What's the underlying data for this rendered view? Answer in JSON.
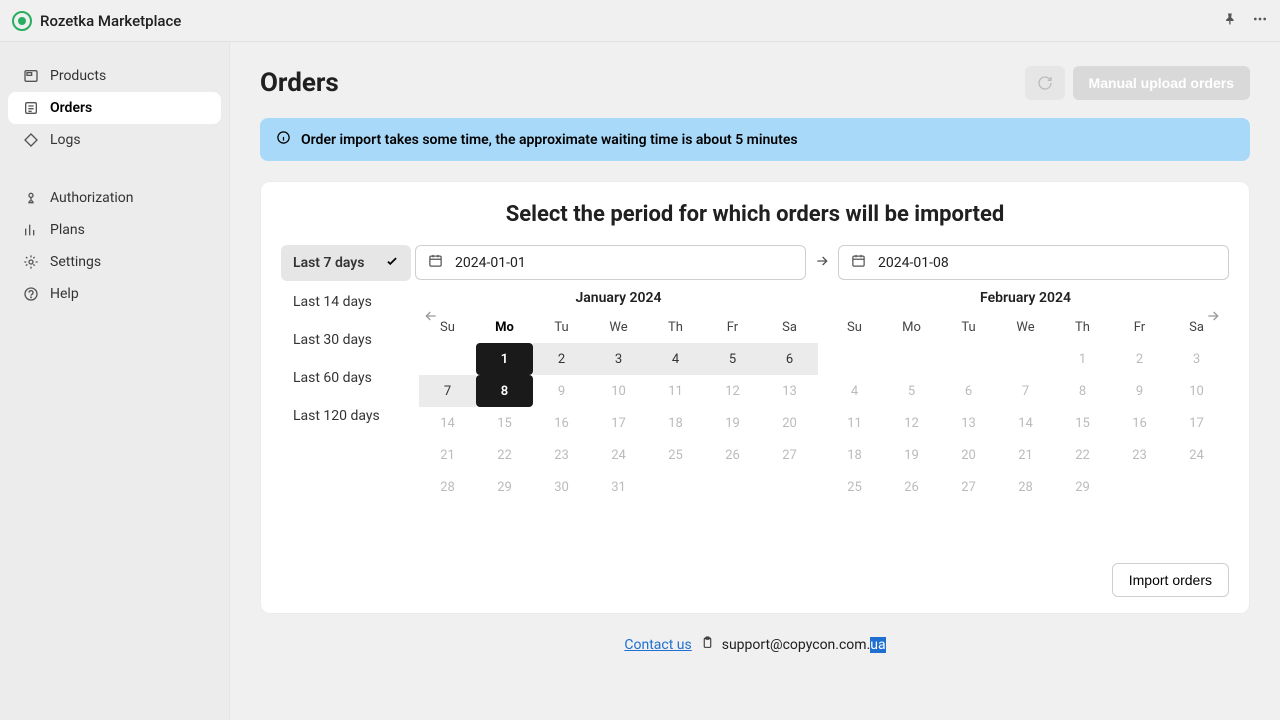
{
  "topbar": {
    "title": "Rozetka Marketplace"
  },
  "sidebar": {
    "group1": [
      {
        "label": "Products"
      },
      {
        "label": "Orders"
      },
      {
        "label": "Logs"
      }
    ],
    "group2": [
      {
        "label": "Authorization"
      },
      {
        "label": "Plans"
      },
      {
        "label": "Settings"
      },
      {
        "label": "Help"
      }
    ]
  },
  "page": {
    "title": "Orders",
    "manual_upload_label": "Manual upload orders"
  },
  "alert": {
    "text": "Order import takes some time, the approximate waiting time is about 5 minutes"
  },
  "card": {
    "title": "Select the period for which orders will be imported",
    "start_value": "2024-01-01",
    "end_value": "2024-01-08",
    "import_label": "Import orders"
  },
  "presets": [
    {
      "label": "Last 7 days",
      "active": true
    },
    {
      "label": "Last 14 days"
    },
    {
      "label": "Last 30 days"
    },
    {
      "label": "Last 60 days"
    },
    {
      "label": "Last 120 days"
    }
  ],
  "dow": [
    "Su",
    "Mo",
    "Tu",
    "We",
    "Th",
    "Fr",
    "Sa"
  ],
  "months": [
    {
      "title": "January 2024",
      "today_dow_index": 1,
      "weeks": [
        [
          "",
          "1",
          "2",
          "3",
          "4",
          "5",
          "6"
        ],
        [
          "7",
          "8",
          "9",
          "10",
          "11",
          "12",
          "13"
        ],
        [
          "14",
          "15",
          "16",
          "17",
          "18",
          "19",
          "20"
        ],
        [
          "21",
          "22",
          "23",
          "24",
          "25",
          "26",
          "27"
        ],
        [
          "28",
          "29",
          "30",
          "31",
          "",
          "",
          ""
        ]
      ],
      "range_start": [
        0,
        1
      ],
      "range_end": [
        1,
        1
      ]
    },
    {
      "title": "February 2024",
      "weeks": [
        [
          "",
          "",
          "",
          "",
          "1",
          "2",
          "3"
        ],
        [
          "4",
          "5",
          "6",
          "7",
          "8",
          "9",
          "10"
        ],
        [
          "11",
          "12",
          "13",
          "14",
          "15",
          "16",
          "17"
        ],
        [
          "18",
          "19",
          "20",
          "21",
          "22",
          "23",
          "24"
        ],
        [
          "25",
          "26",
          "27",
          "28",
          "29",
          "",
          ""
        ]
      ],
      "range_start": null,
      "range_end": null
    }
  ],
  "footer": {
    "contact": "Contact us",
    "email_prefix": "support@copycon.com.",
    "email_sel": "ua"
  }
}
